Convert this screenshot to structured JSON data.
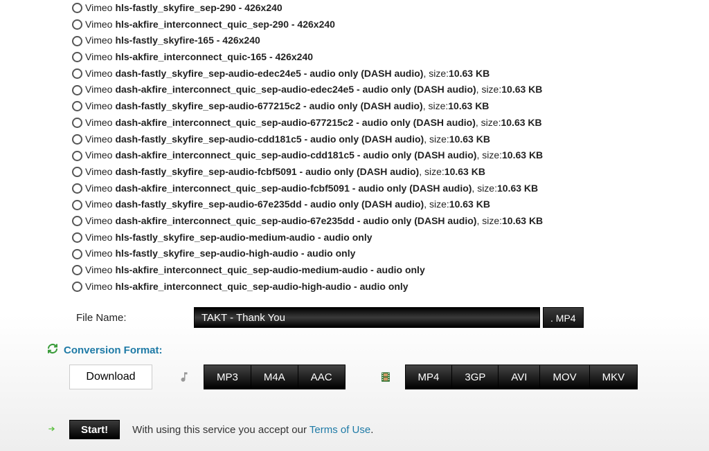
{
  "formats": [
    {
      "source": "Vimeo",
      "name": "hls-fastly_skyfire_sep-290 - 426x240",
      "size": null
    },
    {
      "source": "Vimeo",
      "name": "hls-akfire_interconnect_quic_sep-290 - 426x240",
      "size": null
    },
    {
      "source": "Vimeo",
      "name": "hls-fastly_skyfire-165 - 426x240",
      "size": null
    },
    {
      "source": "Vimeo",
      "name": "hls-akfire_interconnect_quic-165 - 426x240",
      "size": null
    },
    {
      "source": "Vimeo",
      "name": "dash-fastly_skyfire_sep-audio-edec24e5 - audio only (DASH audio)",
      "size": "10.63 KB"
    },
    {
      "source": "Vimeo",
      "name": "dash-akfire_interconnect_quic_sep-audio-edec24e5 - audio only (DASH audio)",
      "size": "10.63 KB"
    },
    {
      "source": "Vimeo",
      "name": "dash-fastly_skyfire_sep-audio-677215c2 - audio only (DASH audio)",
      "size": "10.63 KB"
    },
    {
      "source": "Vimeo",
      "name": "dash-akfire_interconnect_quic_sep-audio-677215c2 - audio only (DASH audio)",
      "size": "10.63 KB"
    },
    {
      "source": "Vimeo",
      "name": "dash-fastly_skyfire_sep-audio-cdd181c5 - audio only (DASH audio)",
      "size": "10.63 KB"
    },
    {
      "source": "Vimeo",
      "name": "dash-akfire_interconnect_quic_sep-audio-cdd181c5 - audio only (DASH audio)",
      "size": "10.63 KB"
    },
    {
      "source": "Vimeo",
      "name": "dash-fastly_skyfire_sep-audio-fcbf5091 - audio only (DASH audio)",
      "size": "10.63 KB"
    },
    {
      "source": "Vimeo",
      "name": "dash-akfire_interconnect_quic_sep-audio-fcbf5091 - audio only (DASH audio)",
      "size": "10.63 KB"
    },
    {
      "source": "Vimeo",
      "name": "dash-fastly_skyfire_sep-audio-67e235dd - audio only (DASH audio)",
      "size": "10.63 KB"
    },
    {
      "source": "Vimeo",
      "name": "dash-akfire_interconnect_quic_sep-audio-67e235dd - audio only (DASH audio)",
      "size": "10.63 KB"
    },
    {
      "source": "Vimeo",
      "name": "hls-fastly_skyfire_sep-audio-medium-audio - audio only",
      "size": null
    },
    {
      "source": "Vimeo",
      "name": "hls-fastly_skyfire_sep-audio-high-audio - audio only",
      "size": null
    },
    {
      "source": "Vimeo",
      "name": "hls-akfire_interconnect_quic_sep-audio-medium-audio - audio only",
      "size": null
    },
    {
      "source": "Vimeo",
      "name": "hls-akfire_interconnect_quic_sep-audio-high-audio - audio only",
      "size": null
    }
  ],
  "size_label": ", size: ",
  "filename": {
    "label": "File Name:",
    "value": "TAKT - Thank You",
    "ext": ". MP4"
  },
  "conversion": {
    "label": "Conversion Format:",
    "download": "Download",
    "audio_formats": [
      "MP3",
      "M4A",
      "AAC"
    ],
    "video_formats": [
      "MP4",
      "3GP",
      "AVI",
      "MOV",
      "MKV"
    ]
  },
  "start": {
    "button": "Start!",
    "text_prefix": "With using this service you accept our ",
    "link": "Terms of Use",
    "text_suffix": "."
  }
}
